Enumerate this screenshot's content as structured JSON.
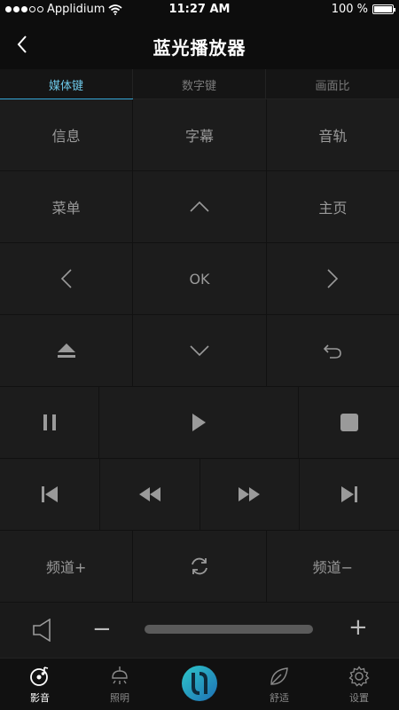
{
  "status": {
    "carrier": "Applidium",
    "time": "11:27 AM",
    "battery_text": "100 %",
    "battery_level": 1.0
  },
  "nav": {
    "title": "蓝光播放器"
  },
  "tabs": [
    {
      "label": "媒体键",
      "active": true
    },
    {
      "label": "数字键",
      "active": false
    },
    {
      "label": "画面比",
      "active": false
    }
  ],
  "keys": {
    "info": "信息",
    "subtitle": "字幕",
    "audio": "音轨",
    "menu": "菜单",
    "home": "主页",
    "ok": "OK",
    "channel_up": "频道+",
    "channel_down": "频道−"
  },
  "volume": {
    "minus": "−",
    "plus": "+"
  },
  "bottom_tabs": [
    {
      "label": "影音",
      "icon": "music-disc-icon",
      "active": true
    },
    {
      "label": "照明",
      "icon": "lamp-icon",
      "active": false
    },
    {
      "label": "",
      "icon": "app-logo-icon",
      "active": false
    },
    {
      "label": "舒适",
      "icon": "leaf-icon",
      "active": false
    },
    {
      "label": "设置",
      "icon": "gear-icon",
      "active": false
    }
  ],
  "colors": {
    "accent": "#35a7d8",
    "background": "#141414",
    "key_background": "#1c1c1c"
  }
}
